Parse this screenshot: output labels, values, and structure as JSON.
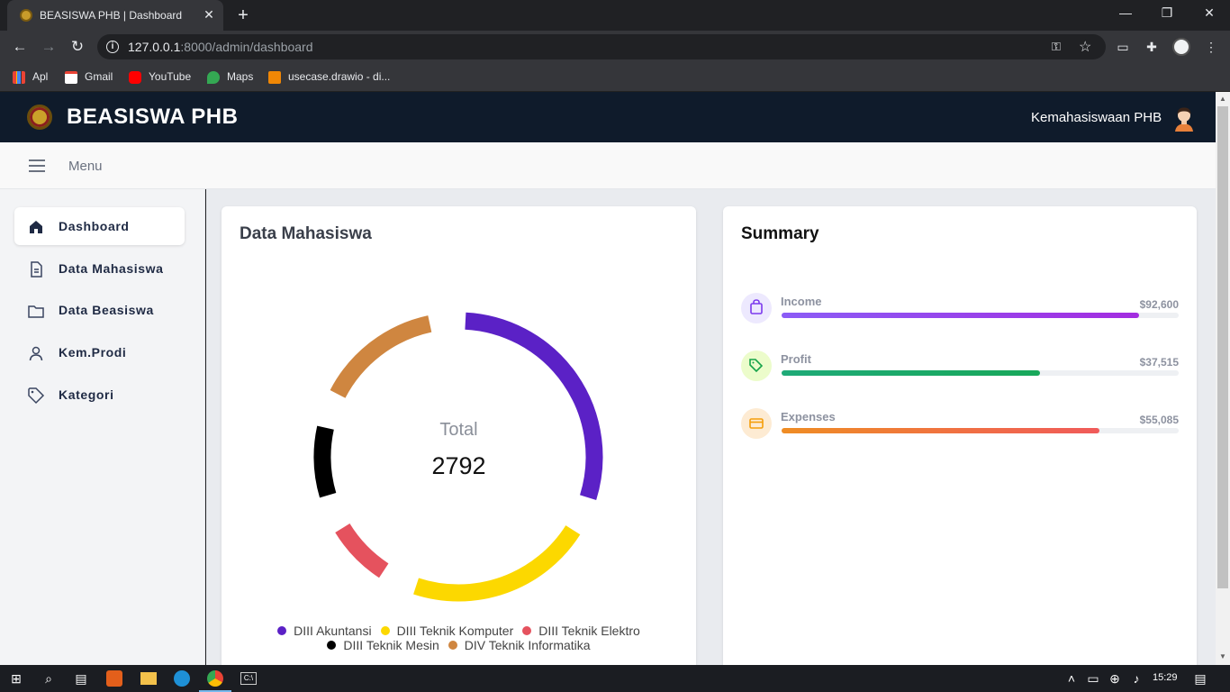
{
  "browser": {
    "tab_title": "BEASISWA PHB | Dashboard",
    "close_tab": "✕",
    "new_tab": "+",
    "url_host": "127.0.0.1",
    "url_rest": ":8000/admin/dashboard",
    "bookmarks": [
      "Apl",
      "Gmail",
      "YouTube",
      "Maps",
      "usecase.drawio - di..."
    ]
  },
  "app": {
    "brand": "BEASISWA PHB",
    "user": "Kemahasiswaan PHB",
    "menu_label": "Menu"
  },
  "sidebar": {
    "items": [
      {
        "label": "Dashboard",
        "icon": "home-icon",
        "active": true
      },
      {
        "label": "Data Mahasiswa",
        "icon": "document-icon",
        "active": false
      },
      {
        "label": "Data Beasiswa",
        "icon": "folder-icon",
        "active": false
      },
      {
        "label": "Kem.Prodi",
        "icon": "user-icon",
        "active": false
      },
      {
        "label": "Kategori",
        "icon": "tag-icon",
        "active": false
      }
    ]
  },
  "mahasiswa_card": {
    "title": "Data Mahasiswa",
    "total_label": "Total",
    "total_value": "2792"
  },
  "chart_data": {
    "type": "pie",
    "title": "Data Mahasiswa",
    "categories": [
      "DIII Akuntansi",
      "DIII Teknik Komputer",
      "DIII Teknik Elektro",
      "DIII Teknik Mesin",
      "DIV Teknik Informatika"
    ],
    "values": [
      0.29,
      0.21,
      0.07,
      0.08,
      0.14
    ],
    "colors": [
      "#5b21c6",
      "#fcd800",
      "#e5525e",
      "#000000",
      "#cf8640"
    ],
    "total": 2792,
    "legend_position": "bottom"
  },
  "summary": {
    "title": "Summary",
    "items": [
      {
        "label": "Income",
        "value": "$92,600",
        "fraction": 0.9,
        "icon": "shopping-bag-icon",
        "bg": "#ede9fe",
        "color": "#7c3aed",
        "grad": "linear-gradient(90deg,#8b5cf6,#a32ce0)"
      },
      {
        "label": "Profit",
        "value": "$37,515",
        "fraction": 0.65,
        "icon": "tag-icon",
        "bg": "#ecfccb",
        "color": "#16a34a",
        "grad": "linear-gradient(90deg,#1faa78,#18a85a)"
      },
      {
        "label": "Expenses",
        "value": "$55,085",
        "fraction": 0.8,
        "icon": "credit-card-icon",
        "bg": "#fdebd3",
        "color": "#f59e0b",
        "grad": "linear-gradient(90deg,#ef8d24,#f05a5a)"
      }
    ]
  },
  "taskbar": {
    "time": "15:29"
  }
}
